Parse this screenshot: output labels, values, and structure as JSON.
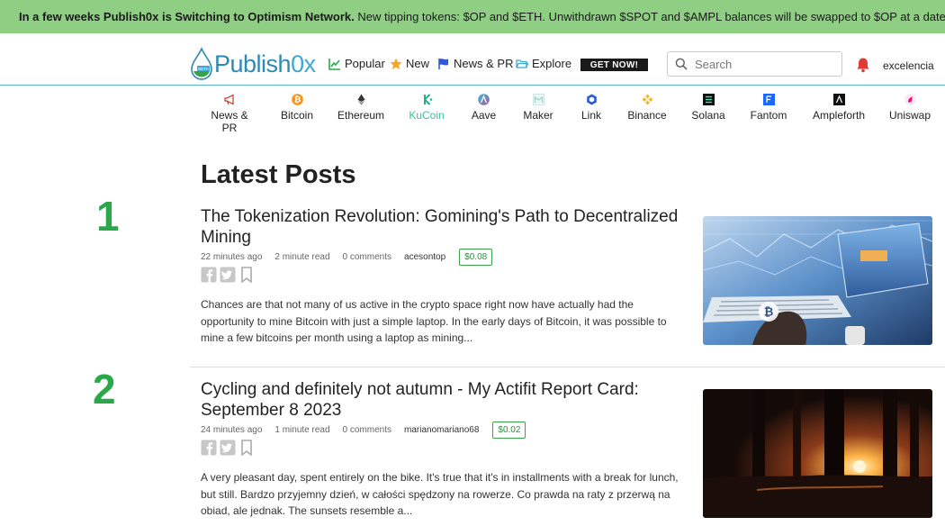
{
  "banner": {
    "bold": "In a few weeks Publish0x is Switching to Optimism Network.",
    "rest": " New tipping tokens: $OP and $ETH. Unwithdrawn $SPOT and $AMPL balances will be swapped to $OP at a date we will announce"
  },
  "logo": {
    "text_a": "Publish",
    "text_b": "0x",
    "badge": "BETA"
  },
  "nav": {
    "popular": "Popular",
    "new": "New",
    "news": "News & PR",
    "explore": "Explore",
    "getnow": "GET NOW!"
  },
  "search": {
    "placeholder": "Search"
  },
  "user": {
    "name": "excelencia"
  },
  "categories": [
    {
      "label": "News & PR",
      "icon": "megaphone-icon"
    },
    {
      "label": "Bitcoin",
      "icon": "bitcoin-icon"
    },
    {
      "label": "Ethereum",
      "icon": "ethereum-icon"
    },
    {
      "label": "KuCoin",
      "icon": "kucoin-icon"
    },
    {
      "label": "Aave",
      "icon": "aave-icon"
    },
    {
      "label": "Maker",
      "icon": "maker-icon"
    },
    {
      "label": "Link",
      "icon": "chainlink-icon"
    },
    {
      "label": "Binance",
      "icon": "binance-icon"
    },
    {
      "label": "Solana",
      "icon": "solana-icon"
    },
    {
      "label": "Fantom",
      "icon": "fantom-icon"
    },
    {
      "label": "Ampleforth",
      "icon": "ampleforth-icon"
    },
    {
      "label": "Uniswap",
      "icon": "uniswap-icon"
    }
  ],
  "main": {
    "title": "Latest Posts"
  },
  "posts": [
    {
      "rank": "1",
      "title": "The Tokenization Revolution: Gomining's Path to Decentralized Mining",
      "time": "22 minutes ago",
      "read": "2 minute read",
      "comments": "0 comments",
      "author": "acesontop",
      "tip": "$0.08",
      "excerpt": "Chances are that not many of us active in the crypto space right now have actually had the opportunity to mine Bitcoin with just a simple laptop. In the early days of Bitcoin, it was possible to mine a few bitcoins per month using a laptop as mining..."
    },
    {
      "rank": "2",
      "title": "Cycling and definitely not autumn - My Actifit Report Card: September 8 2023",
      "time": "24 minutes ago",
      "read": "1 minute read",
      "comments": "0 comments",
      "author": "marianomariano68",
      "tip": "$0.02",
      "excerpt": "A very pleasant day, spent entirely on the bike. It's true that it's in installments with a break for lunch, but still. Bardzo przyjemny dzień, w całości spędzony na rowerze. Co prawda na raty z przerwą na obiad, ale jednak. The sunsets resemble a..."
    }
  ],
  "colors": {
    "banner": "#8fcf83",
    "accent": "#2d8ab5",
    "rank": "#2aa84a",
    "tip": "#3aa34a",
    "kucoin": "#3dbf9a"
  }
}
